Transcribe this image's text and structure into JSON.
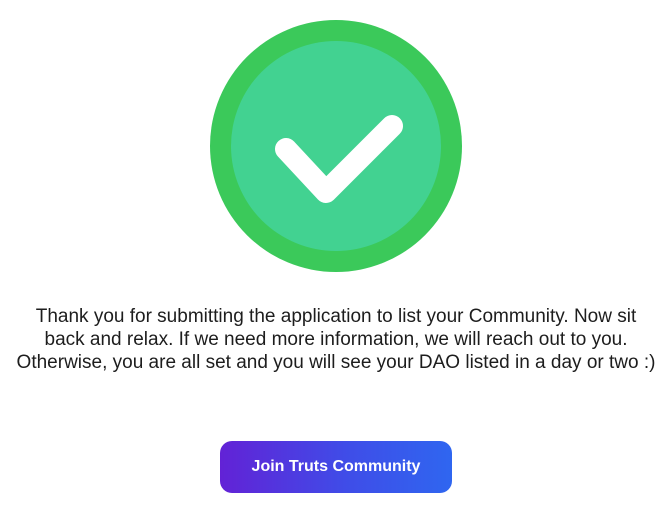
{
  "success": {
    "icon": "checkmark-icon",
    "colors": {
      "outer": "#3bc95a",
      "inner": "#42d291",
      "check": "#ffffff"
    }
  },
  "message": "Thank you for submitting the application to list your Community. Now sit back and relax. If we need more information, we will reach out to you. Otherwise, you are all set and you will see your DAO listed in a day or two :)",
  "join_button": {
    "label": "Join Truts Community",
    "gradient_start": "#6222d6",
    "gradient_end": "#2f66f0"
  }
}
